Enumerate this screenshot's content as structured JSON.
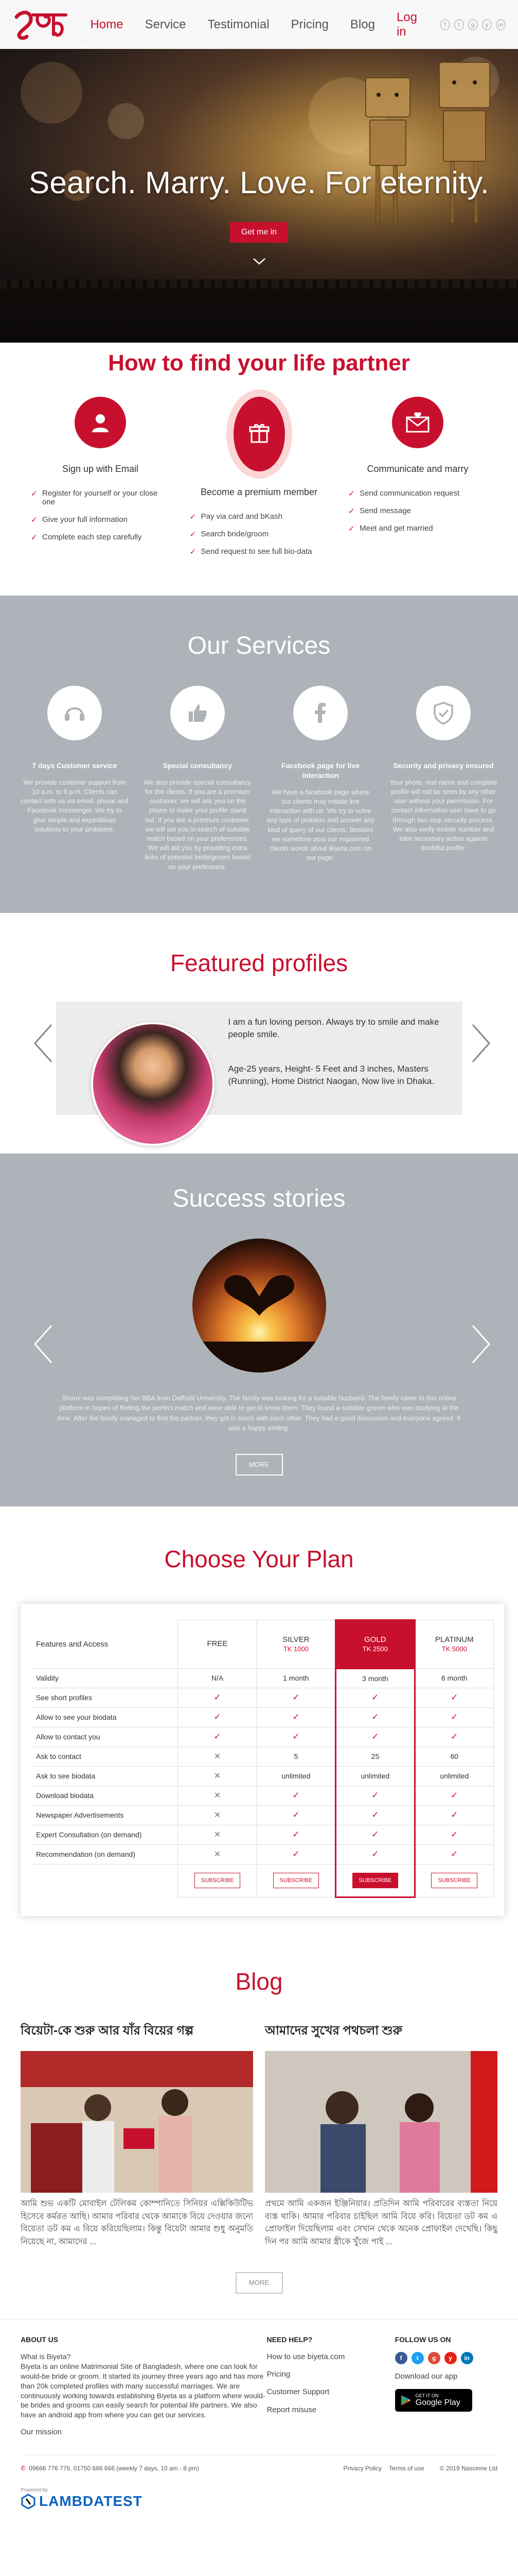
{
  "nav": {
    "links": [
      "Home",
      "Service",
      "Testimonial",
      "Pricing",
      "Blog"
    ],
    "login": "Log in",
    "social": [
      "f",
      "t",
      "g",
      "y",
      "in"
    ]
  },
  "hero": {
    "title": "Search. Marry. Love. For eternity.",
    "button": "Get me in"
  },
  "howto": {
    "title": "How to find your life partner",
    "cols": [
      {
        "icon": "user-icon",
        "head": "Sign up with Email",
        "items": [
          "Register for yourself or your close one",
          "Give your full information",
          "Complete each step carefully"
        ]
      },
      {
        "icon": "gift-icon",
        "head": "Become a premium member",
        "items": [
          "Pay via card and bKash",
          "Search bride/groom",
          "Send request to see full bio-data"
        ]
      },
      {
        "icon": "mail-icon",
        "head": "Communicate and marry",
        "items": [
          "Send communication request",
          "Send message",
          "Meet and get married"
        ]
      }
    ]
  },
  "services": {
    "title": "Our Services",
    "cols": [
      {
        "icon": "headset-icon",
        "head": "7 days Customer service",
        "body": "We provide customer support from 10 a.m. to 8 p.m. Clients can contact with us via email, phone and Facebook messenger. We try to give simple and expeditious solutions to your problems."
      },
      {
        "icon": "thumbs-up-icon",
        "head": "Special consultancy",
        "body": "We also provide special consultancy for the clients. If you are a premium customer, we will ask you on the phone to make your profile stand out. If you are a premium customer, we will aid you in search of suitable match based on your preferences. We will aid you by providing extra links of potential bride/groom based on your preference."
      },
      {
        "icon": "facebook-icon",
        "head": "Facebook page for live interaction",
        "body": "We have a facebook page where our clients may initiate live interaction with us. We try to solve any type of problem and answer any kind of query of our clients. Besides we sometime post our registered clients words about Biyeta.com on our page."
      },
      {
        "icon": "shield-icon",
        "head": "Security and privacy ensured",
        "body": "Your photo, real name and complete profile will not be seen by any other user without your permission. For contact information user have to go through two step security process. We also verify mobile number and take necessary action against doubtful profile."
      }
    ]
  },
  "featured": {
    "title": "Featured profiles",
    "about": "I am a fun loving person. Always try to smile and make people smile.",
    "details": "Age-25 years, Height- 5 Feet and 3 inches, Masters (Running), Home District Naogan, Now live in Dhaka."
  },
  "success": {
    "title": "Success stories",
    "text": "Shomi was completing her BBA from Daffodil University. The family was looking for a suitable husband. The family came to this online platform in hopes of finding the perfect match and were able to get to know them. They found a suitable groom who was studying at the time. After the family managed to find the partner, they got in touch with each other. They had a good discussion and everyone agreed. It was a happy ending.",
    "more": "MORE"
  },
  "plan": {
    "title": "Choose Your Plan",
    "feature_header": "Features and Access",
    "plans": [
      {
        "name": "FREE",
        "price": ""
      },
      {
        "name": "SILVER",
        "price": "TK 1000"
      },
      {
        "name": "GOLD",
        "price": "TK 2500"
      },
      {
        "name": "PLATINUM",
        "price": "TK 5000"
      }
    ],
    "rows": [
      {
        "feature": "Validity",
        "values": [
          "N/A",
          "1 month",
          "3 month",
          "6 month"
        ]
      },
      {
        "feature": "See short profiles",
        "values": [
          "tick",
          "tick",
          "tick",
          "tick"
        ]
      },
      {
        "feature": "Allow to see your biodata",
        "values": [
          "tick",
          "tick",
          "tick",
          "tick"
        ]
      },
      {
        "feature": "Allow to contact you",
        "values": [
          "tick",
          "tick",
          "tick",
          "tick"
        ]
      },
      {
        "feature": "Ask to contact",
        "values": [
          "cross",
          "5",
          "25",
          "60"
        ]
      },
      {
        "feature": "Ask to see biodata",
        "values": [
          "cross",
          "unlimited",
          "unlimited",
          "unlimited"
        ]
      },
      {
        "feature": "Download biodata",
        "values": [
          "cross",
          "tick",
          "tick",
          "tick"
        ]
      },
      {
        "feature": "Newspaper Advertisements",
        "values": [
          "cross",
          "tick",
          "tick",
          "tick"
        ]
      },
      {
        "feature": "Expert Consultation (on demand)",
        "values": [
          "cross",
          "tick",
          "tick",
          "tick"
        ]
      },
      {
        "feature": "Recommendation (on demand)",
        "values": [
          "cross",
          "tick",
          "tick",
          "tick"
        ]
      }
    ],
    "subscribe": "SUBSCRIBE"
  },
  "blog": {
    "title": "Blog",
    "posts": [
      {
        "title": "বিয়েটা-কে শুরু আর যাঁর বিয়ের গল্প",
        "text": "আমি শুভ একটি মোবাইল টেলিকম কোম্পানিতে সিনিয়র এক্সিকিউটিভ হিসেবে কর্মরত আছি। আমার পরিবার থেকে আমাকে বিয়ে দেওয়ার জন্যে বিয়েতা ডট কম এ বিয়ে করিয়েছিলাম। কিন্তু বিয়েটা আমার শুধু অনুমতি নিয়েছে না, আমাদের ..."
      },
      {
        "title": "আমাদের সুখের পথচলা শুরু",
        "text": "প্রথমে আমি একজন ইঞ্জিনিয়ার। প্রতিদিন আমি পরিবারের ব্যস্ততা নিয়ে ব্যস্ত থাকি। আমার পরিবার চাইছিল আমি বিয়ে করি। বিয়েতা ডট কম এ প্রোফাইল দিয়েছিলাম এবং সেখান থেকে অনেক প্রোফাইল দেখেছি। কিছু দিন পর আমি আমার স্ত্রীকে খুঁজে পাই ..."
      }
    ],
    "more": "MORE"
  },
  "footer": {
    "about_title": "ABOUT US",
    "about_q": "What is Biyeta?",
    "about_text": "Biyeta is an online Matrimonial Site of Bangladesh, where one can look for would-be bride or groom. It started its journey three years ago and has more than 20k completed profiles with many successful marriages. We are continuously working towards establishing Biyeta as a platform where would-be brides and grooms can easily search for potential life partners. We also have an android app from where you can get our services.",
    "mission": "Our mission",
    "help_title": "NEED HELP?",
    "help_items": [
      "How to use biyeta.com",
      "Pricing",
      "Customer Support",
      "Report misuse"
    ],
    "follow_title": "FOLLOW US ON",
    "download": "Download our app",
    "gplay_small": "GET IT ON",
    "gplay_big": "Google Play",
    "phone": "09666 776 776, 01750 666 666 (weekly 7 days, 10 am - 8 pm)",
    "links": [
      "Privacy Policy",
      "Terms of use"
    ],
    "copyright": "© 2019 Nascinne Ltd"
  },
  "powered": {
    "small": "Powered by",
    "brand": "LAMBDATEST"
  },
  "colors": {
    "brand": "#c8102e",
    "gray_section": "#adb3b8"
  }
}
